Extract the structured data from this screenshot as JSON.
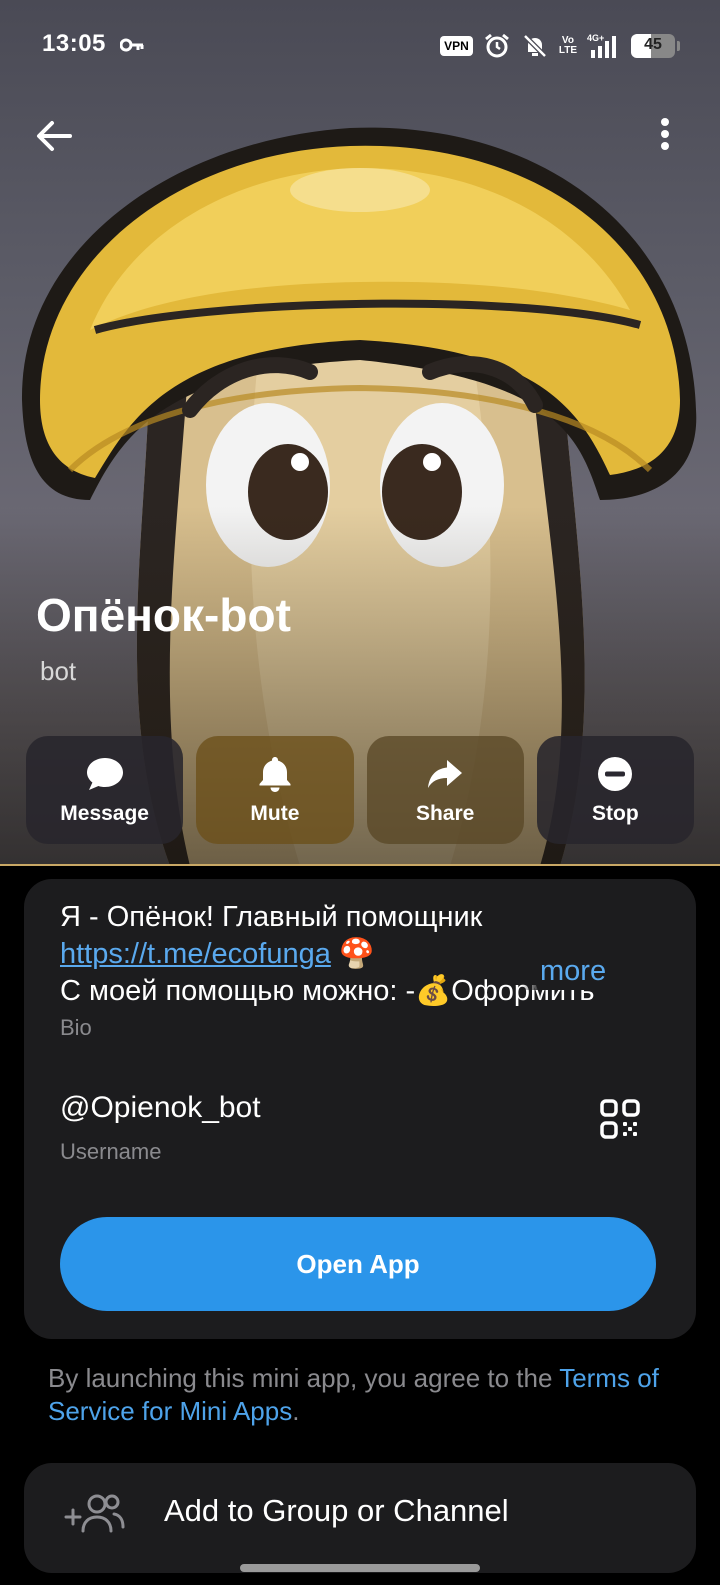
{
  "status_bar": {
    "time": "13:05",
    "vpn": "VPN",
    "volte_top": "Vo",
    "volte_bottom": "LTE",
    "network": "4G+",
    "battery": "45",
    "battery_fraction": 0.45,
    "icons": [
      "key-icon",
      "alarm-icon",
      "bell-off-icon",
      "signal-icon",
      "battery-icon"
    ]
  },
  "header": {
    "back_icon": "arrow-left-icon",
    "menu_icon": "more-vertical-icon"
  },
  "profile": {
    "name": "Опёнок-bot",
    "status": "bot"
  },
  "actions": [
    {
      "label": "Message",
      "icon": "message-icon"
    },
    {
      "label": "Mute",
      "icon": "bell-icon"
    },
    {
      "label": "Share",
      "icon": "share-icon"
    },
    {
      "label": "Stop",
      "icon": "stop-icon"
    }
  ],
  "info": {
    "bio_line1": "Я - Опёнок! Главный помощник",
    "bio_link": "https://t.me/ecofunga",
    "bio_emoji": "🍄",
    "bio_line3": "С моей помощью можно: -💰Оформить",
    "more_label": "more",
    "bio_label": "Bio",
    "username": "@Opienok_bot",
    "username_label": "Username",
    "qr_icon": "qr-code-icon",
    "open_app_label": "Open App"
  },
  "terms": {
    "prefix": "By launching this mini app, you agree to the ",
    "link": "Terms of Service for Mini Apps",
    "suffix": "."
  },
  "add_group": {
    "label": "Add to Group or Channel",
    "icon": "add-users-icon"
  },
  "colors": {
    "accent": "#2b95ea",
    "link": "#5aa9ee",
    "card": "#1c1c1e",
    "background": "#000000"
  }
}
